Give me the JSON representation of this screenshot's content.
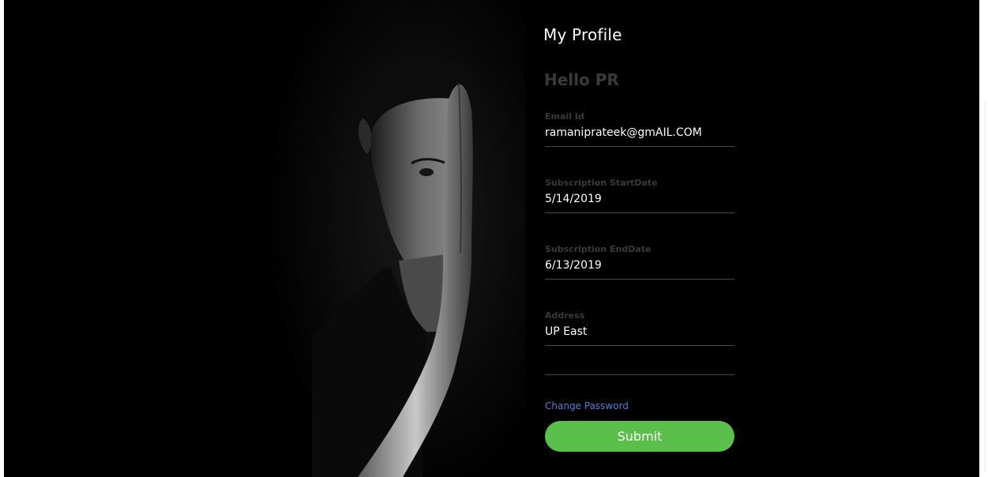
{
  "profile": {
    "title": "My Profile",
    "greeting": "Hello PR",
    "fields": [
      {
        "label": "Email Id",
        "value": "ramaniprateek@gmAIL.COM"
      },
      {
        "label": "Subscription StartDate",
        "value": "5/14/2019"
      },
      {
        "label": "Subscription EndDate",
        "value": "6/13/2019"
      },
      {
        "label": "Address",
        "value": "UP East"
      }
    ],
    "change_password_label": "Change Password",
    "submit_label": "Submit"
  },
  "colors": {
    "background": "#000000",
    "submit_button": "#5bbf4c",
    "link": "#4f7fd6",
    "label_muted": "#3a3a3a"
  },
  "images": {
    "portrait": "man-covering-half-face-with-hand"
  }
}
